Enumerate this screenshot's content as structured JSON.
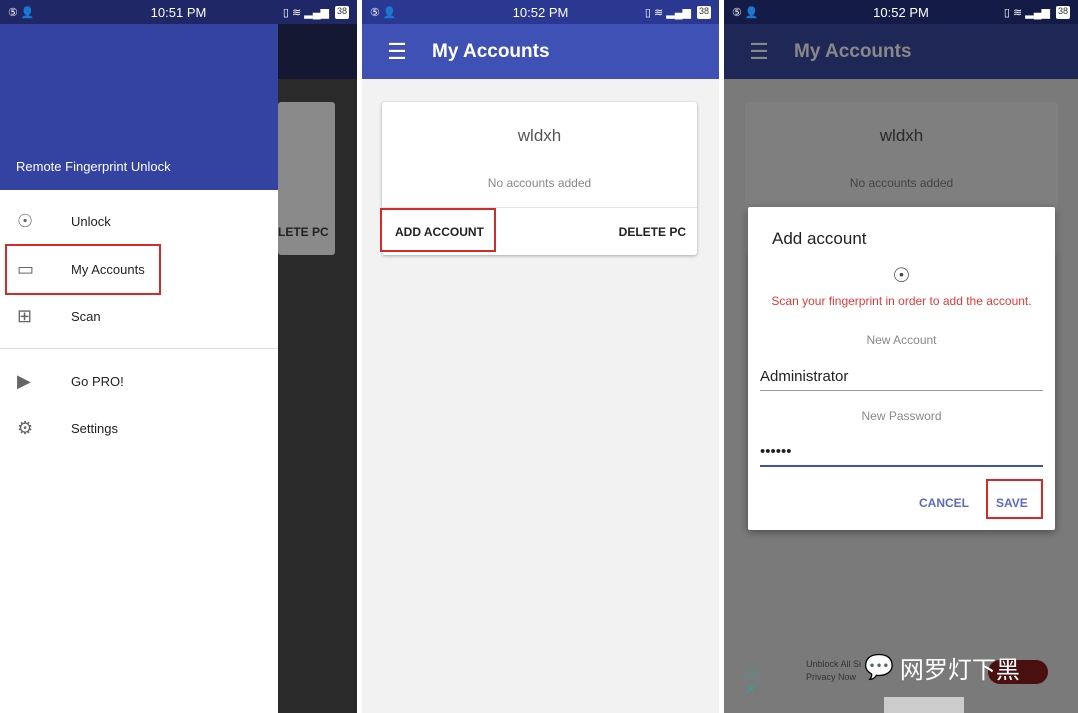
{
  "screens": [
    {
      "status": {
        "time": "10:51 PM",
        "battery": "38"
      },
      "drawer": {
        "header": "Remote Fingerprint Unlock",
        "items": [
          {
            "label": "Unlock",
            "icon": "fingerprint-icon"
          },
          {
            "label": "My Accounts",
            "icon": "laptop-icon"
          },
          {
            "label": "Scan",
            "icon": "monitor-plus-icon"
          },
          {
            "label": "Go PRO!",
            "icon": "play-store-icon"
          },
          {
            "label": "Settings",
            "icon": "gear-icon"
          }
        ]
      },
      "behind": {
        "button": "LETE PC"
      }
    },
    {
      "status": {
        "time": "10:52 PM",
        "battery": "38"
      },
      "appbar": {
        "title": "My Accounts"
      },
      "card": {
        "pc_name": "wldxh",
        "empty": "No accounts added",
        "add": "ADD ACCOUNT",
        "delete": "DELETE PC"
      }
    },
    {
      "status": {
        "time": "10:52 PM",
        "battery": "38"
      },
      "appbar": {
        "title": "My Accounts"
      },
      "card": {
        "pc_name": "wldxh",
        "empty": "No accounts added"
      },
      "dialog": {
        "title": "Add account",
        "instruction": "Scan your fingerprint in order to add the account.",
        "account_label": "New Account",
        "account_value": "Administrator",
        "password_label": "New Password",
        "password_value": "••••••",
        "cancel": "CANCEL",
        "save": "SAVE"
      },
      "ad": {
        "line1": "Unblock All Si",
        "line2": "Privacy Now"
      },
      "watermark": "网罗灯下黑"
    }
  ],
  "colors": {
    "primary": "#3f51b5",
    "accent": "#3f51b5",
    "highlight": "#d62a2a",
    "error": "#e53935"
  }
}
